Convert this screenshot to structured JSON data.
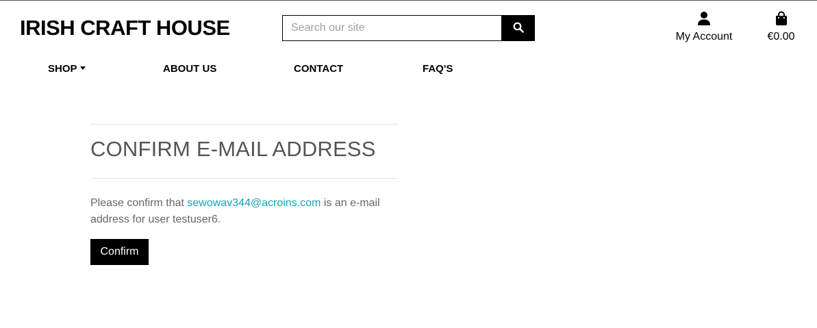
{
  "header": {
    "brand": "IRISH CRAFT HOUSE",
    "search": {
      "placeholder": "Search our site",
      "value": ""
    },
    "account_label": "My Account",
    "bag_total": "€0.00"
  },
  "nav": {
    "shop": "SHOP",
    "about": "ABOUT US",
    "contact": "CONTACT",
    "faq": "FAQ'S"
  },
  "main": {
    "title": "CONFIRM E-MAIL ADDRESS",
    "message_before": "Please confirm that ",
    "email": "sewowav344@acroins.com",
    "message_after": " is an e-mail address for user testuser6.",
    "confirm_label": "Confirm"
  },
  "colors": {
    "link": "#17a2b8",
    "button_bg": "#000000",
    "heading": "#555555",
    "body_text": "#666666"
  }
}
